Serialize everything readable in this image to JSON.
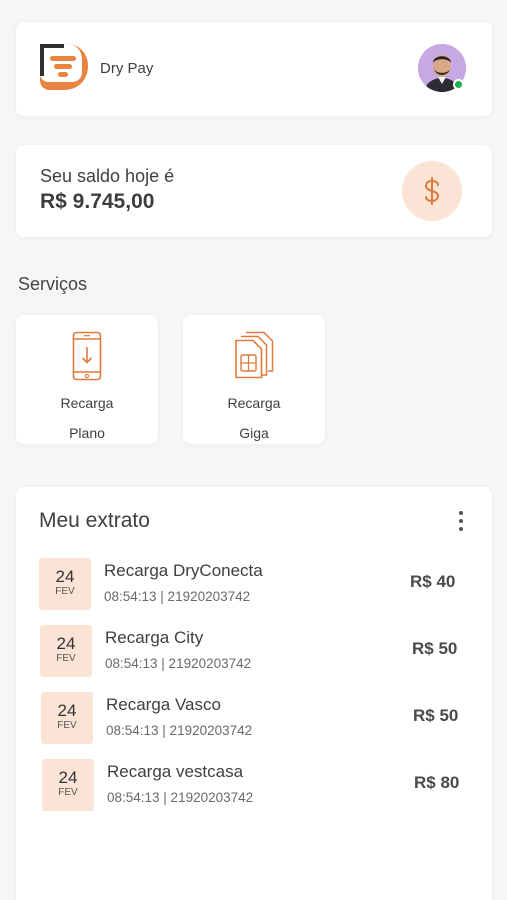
{
  "header": {
    "brand": "Dry Pay",
    "logo_icon": "dry-pay-logo",
    "avatar_icon": "user-avatar",
    "online_color": "#22b24c"
  },
  "balance": {
    "label": "Seu saldo hoje é",
    "value": "R$ 9.745,00",
    "icon": "dollar-icon",
    "accent": "#e07a3a"
  },
  "services": {
    "title": "Serviços",
    "items": [
      {
        "line1": "Recarga",
        "line2": "Plano",
        "icon": "phone-download-icon"
      },
      {
        "line1": "Recarga",
        "line2": "Giga",
        "icon": "sim-card-icon"
      }
    ]
  },
  "statement": {
    "title": "Meu extrato",
    "menu_icon": "more-vertical-icon",
    "items": [
      {
        "day": "24",
        "month": "FEV",
        "title": "Recarga DryConecta",
        "subtitle": "08:54:13 | 21920203742",
        "amount": "R$ 40"
      },
      {
        "day": "24",
        "month": "FEV",
        "title": "Recarga City",
        "subtitle": "08:54:13 | 21920203742",
        "amount": "R$ 50"
      },
      {
        "day": "24",
        "month": "FEV",
        "title": "Recarga Vasco",
        "subtitle": "08:54:13 | 21920203742",
        "amount": "R$ 50"
      },
      {
        "day": "24",
        "month": "FEV",
        "title": "Recarga vestcasa",
        "subtitle": "08:54:13 | 21920203742",
        "amount": "R$ 80"
      }
    ]
  }
}
